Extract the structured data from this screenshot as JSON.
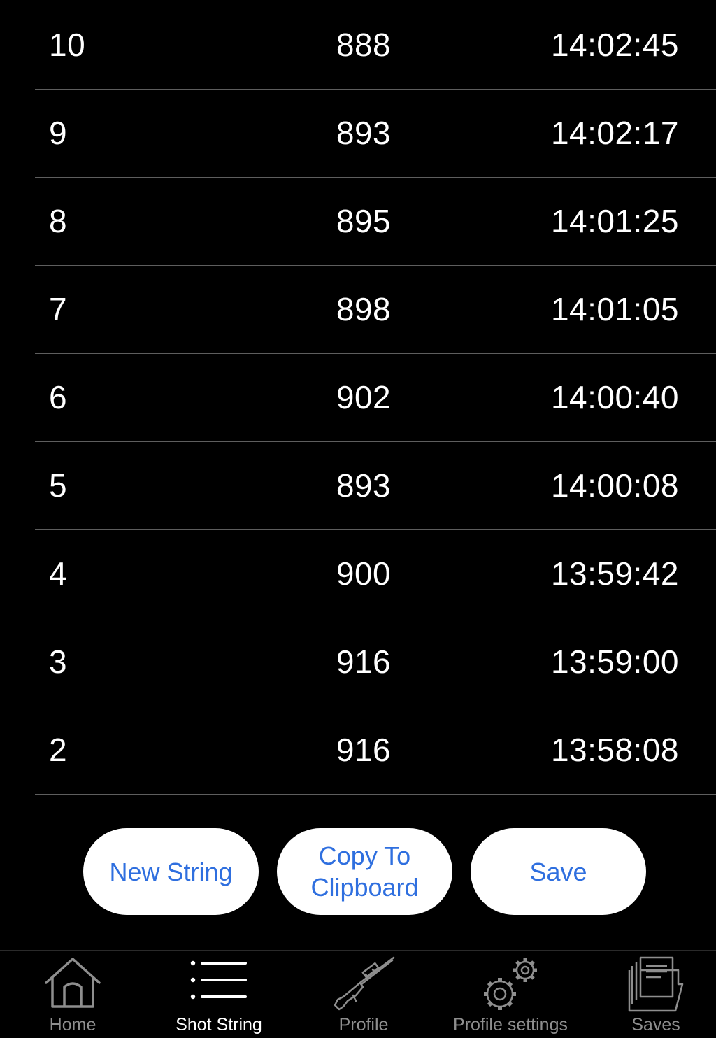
{
  "shots": [
    {
      "number": "10",
      "velocity": "888",
      "time": "14:02:45"
    },
    {
      "number": "9",
      "velocity": "893",
      "time": "14:02:17"
    },
    {
      "number": "8",
      "velocity": "895",
      "time": "14:01:25"
    },
    {
      "number": "7",
      "velocity": "898",
      "time": "14:01:05"
    },
    {
      "number": "6",
      "velocity": "902",
      "time": "14:00:40"
    },
    {
      "number": "5",
      "velocity": "893",
      "time": "14:00:08"
    },
    {
      "number": "4",
      "velocity": "900",
      "time": "13:59:42"
    },
    {
      "number": "3",
      "velocity": "916",
      "time": "13:59:00"
    },
    {
      "number": "2",
      "velocity": "916",
      "time": "13:58:08"
    }
  ],
  "actions": {
    "new_string": "New String",
    "copy_line1": "Copy To",
    "copy_line2": "Clipboard",
    "save": "Save"
  },
  "tabs": [
    {
      "label": "Home",
      "icon": "home-icon",
      "active": false
    },
    {
      "label": "Shot String",
      "icon": "list-icon",
      "active": true
    },
    {
      "label": "Profile",
      "icon": "rifle-icon",
      "active": false
    },
    {
      "label": "Profile settings",
      "icon": "gears-icon",
      "active": false
    },
    {
      "label": "Saves",
      "icon": "folder-icon",
      "active": false
    }
  ],
  "colors": {
    "background": "#000000",
    "button_text": "#2f6fdf",
    "button_bg": "#ffffff",
    "inactive_tab": "#8e8e8e",
    "active_tab": "#ffffff"
  }
}
